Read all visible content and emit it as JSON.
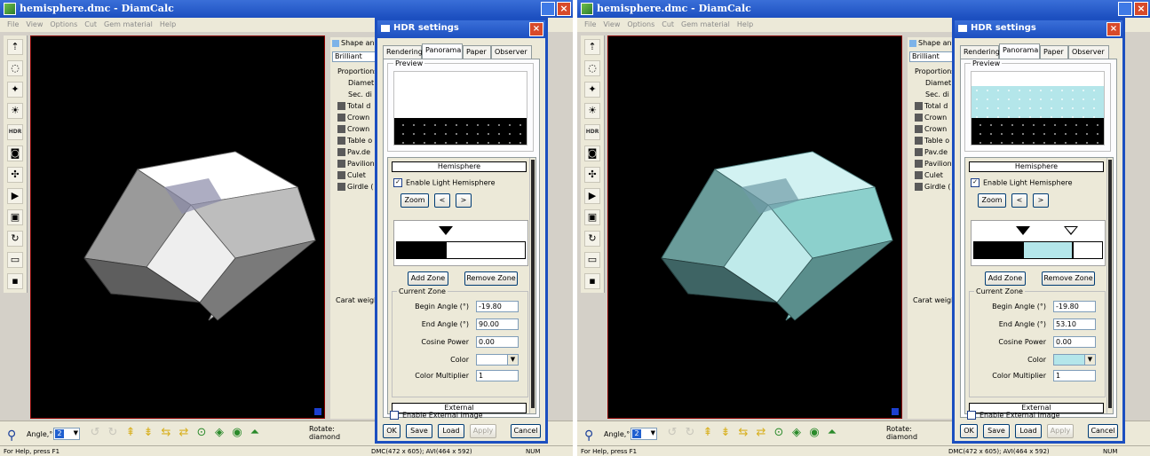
{
  "window": {
    "title": "hemisphere.dmc - DiamCalc",
    "menu": [
      "File",
      "View",
      "Options",
      "Cut",
      "Gem material",
      "Help"
    ]
  },
  "side_panel": {
    "shape_label": "Shape an",
    "shape_value": "Brilliant",
    "proportions_label": "Proportions",
    "items": [
      "Diamet",
      "Sec. di",
      "Total d",
      "Crown",
      "Crown",
      "Table o",
      "Pav.de",
      "Pavilion",
      "Culet",
      "Girdle ("
    ],
    "carat_label": "Carat weight"
  },
  "bottom": {
    "angle_label": "Angle,°",
    "angle_value": "2",
    "rotate_label_1": "Rotate:",
    "rotate_label_2": "diamond",
    "status_help": "For Help, press F1",
    "status_dims": "DMC(472 x 605); AVI(464 x 592)",
    "status_num": "NUM"
  },
  "toolbar_hdr_label": "HDR",
  "dialog": {
    "title": "HDR settings",
    "tabs": [
      "Rendering",
      "Panorama",
      "Paper",
      "Observer"
    ],
    "active_tab": "Panorama",
    "preview_label": "Preview",
    "hemisphere_label": "Hemisphere",
    "enable_light_label": "Enable Light Hemisphere",
    "zoom_label": "Zoom",
    "prev_label": "<",
    "next_label": ">",
    "add_zone_label": "Add Zone",
    "remove_zone_label": "Remove Zone",
    "current_zone_label": "Current Zone",
    "begin_angle_label": "Begin Angle (°)",
    "end_angle_label": "End Angle (°)",
    "cosine_power_label": "Cosine Power",
    "color_label": "Color",
    "color_multiplier_label": "Color Multiplier",
    "external_label": "External",
    "enable_external_label": "Enable External Image",
    "ok_label": "OK",
    "save_label": "Save",
    "load_label": "Load",
    "apply_label": "Apply",
    "cancel_label": "Cancel"
  },
  "panels": [
    {
      "begin_angle": "-19.80",
      "end_angle": "90.00",
      "cosine_power": "0.00",
      "color_multiplier": "1",
      "zone_color": "#ffffff",
      "preview_band_color": "#ffffff",
      "diamond_tint": "#ffffff"
    },
    {
      "begin_angle": "-19.80",
      "end_angle": "53.10",
      "cosine_power": "0.00",
      "color_multiplier": "1",
      "zone_color": "#b4e6ea",
      "preview_band_color": "#b4e6ea",
      "diamond_tint": "#a8e4e4"
    }
  ],
  "colors": {
    "title_blue": "#1c4fc0",
    "zone_black": "#000000",
    "zone_cyan": "#b4e6ea"
  }
}
